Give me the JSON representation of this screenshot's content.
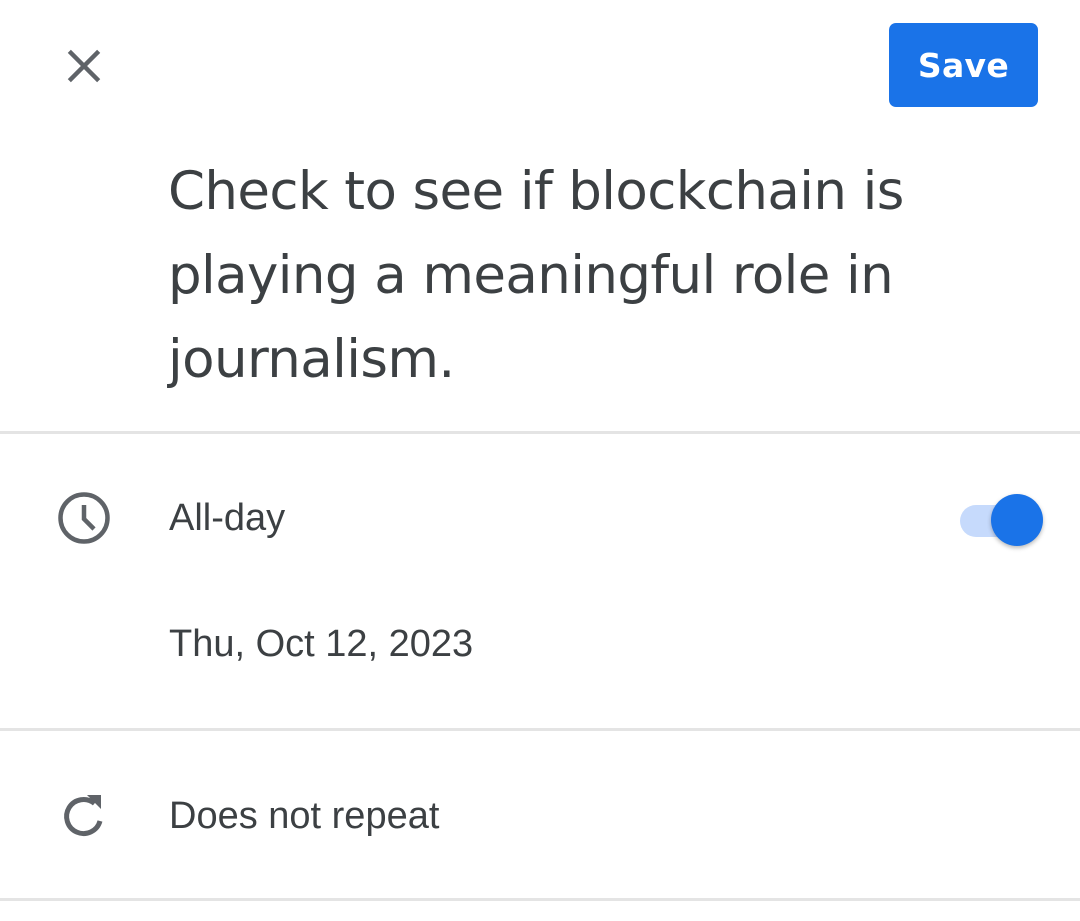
{
  "header": {
    "close_icon": "close-icon",
    "save_label": "Save"
  },
  "event": {
    "title": "Check to see if blockchain is playing a meaningful role in journalism."
  },
  "all_day": {
    "icon": "clock-icon",
    "label": "All-day",
    "enabled": true
  },
  "date": {
    "label": "Thu, Oct 12, 2023"
  },
  "repeat": {
    "icon": "repeat-icon",
    "label": "Does not repeat"
  },
  "colors": {
    "accent": "#1a73e8",
    "toggle_track": "#c6dafc",
    "text": "#3c4043",
    "icon": "#5f6368",
    "divider": "#e4e4e4"
  }
}
